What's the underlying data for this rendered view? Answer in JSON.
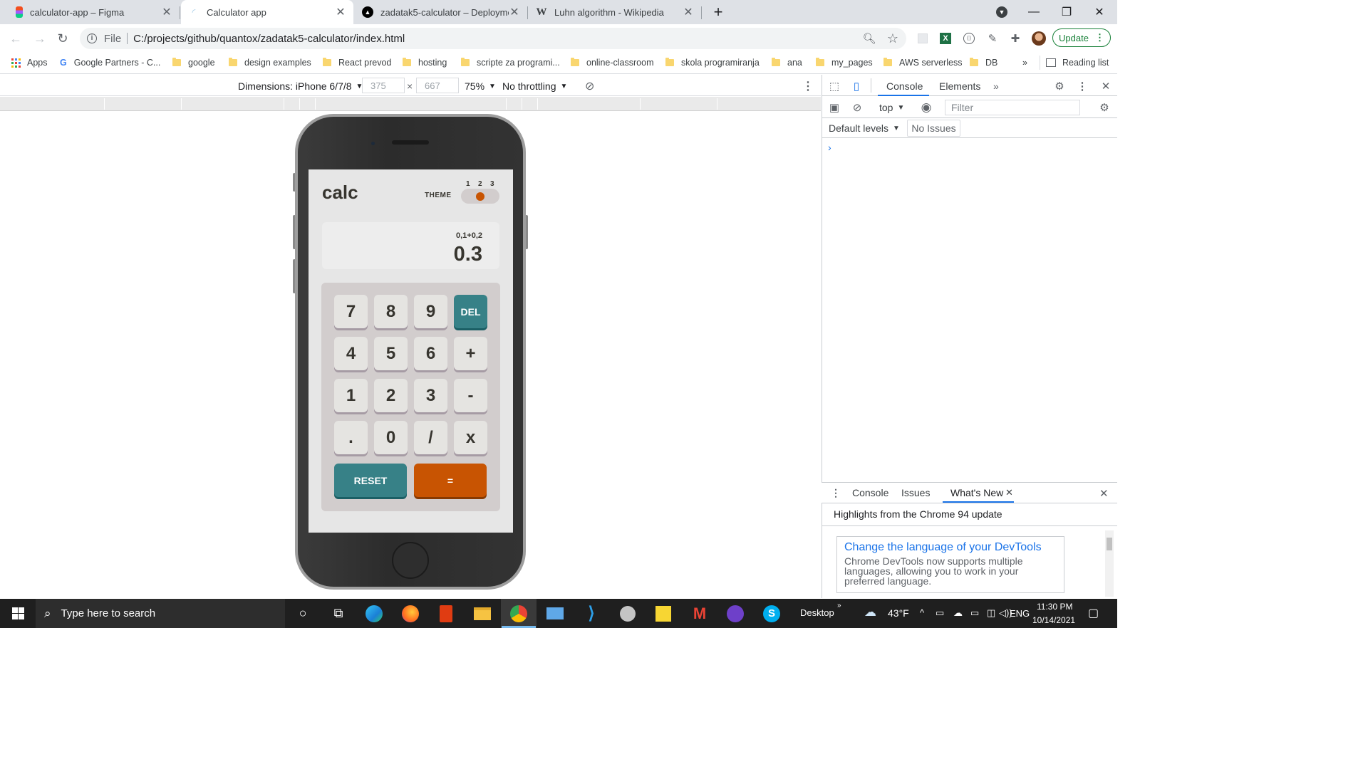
{
  "tabs": [
    {
      "title": "calculator-app – Figma",
      "favicon_color": "#f24e1e",
      "active": false
    },
    {
      "title": "Calculator app",
      "favicon_color": "#9ec9e6",
      "active": true
    },
    {
      "title": "zadatak5-calculator – Deploymen",
      "favicon_color": "#000000",
      "active": false
    },
    {
      "title": "Luhn algorithm - Wikipedia",
      "favicon_color": "#ffffff",
      "active": false
    }
  ],
  "new_tab_icon": "plus-icon",
  "address": {
    "scheme_label": "File",
    "url": "C:/projects/github/quantox/zadatak5-calculator/index.html"
  },
  "update_label": "Update",
  "bookmarks": [
    {
      "label": "Apps",
      "icon": "apps-grid-icon"
    },
    {
      "label": "Google Partners - C...",
      "icon": "google-icon"
    },
    {
      "label": "google",
      "icon": "folder-icon"
    },
    {
      "label": "design examples",
      "icon": "folder-icon"
    },
    {
      "label": "React prevod",
      "icon": "folder-icon"
    },
    {
      "label": "hosting",
      "icon": "folder-icon"
    },
    {
      "label": "scripte za programi...",
      "icon": "folder-icon"
    },
    {
      "label": "online-classroom",
      "icon": "folder-icon"
    },
    {
      "label": "skola programiranja",
      "icon": "folder-icon"
    },
    {
      "label": "ana",
      "icon": "folder-icon"
    },
    {
      "label": "my_pages",
      "icon": "folder-icon"
    },
    {
      "label": "AWS serverless",
      "icon": "folder-icon"
    },
    {
      "label": "DB",
      "icon": "folder-icon"
    }
  ],
  "bookmarks_overflow": "»",
  "reading_list": "Reading list",
  "device_toolbar": {
    "dimensions_label": "Dimensions: iPhone 6/7/8",
    "width": "375",
    "times": "×",
    "height": "667",
    "zoom": "75%",
    "throttling": "No throttling"
  },
  "calculator": {
    "title": "calc",
    "theme_label": "THEME",
    "theme_numbers": [
      "1",
      "2",
      "3"
    ],
    "theme_selected": 2,
    "expression": "0,1+0,2",
    "result": "0.3",
    "keys": [
      "7",
      "8",
      "9",
      "DEL",
      "4",
      "5",
      "6",
      "+",
      "1",
      "2",
      "3",
      "-",
      ".",
      "0",
      "/",
      "x"
    ],
    "reset_label": "RESET",
    "equals_label": "=",
    "colors": {
      "accent": "#c85402",
      "key_teal": "#378187",
      "screen_bg": "#e6e6e6",
      "keypad_bg": "#d2cdcd"
    }
  },
  "devtools": {
    "tabs": [
      "Console",
      "Elements"
    ],
    "active_tab": "Console",
    "more": "»",
    "context": "top",
    "filter_placeholder": "Filter",
    "levels": "Default levels",
    "issues": "No Issues",
    "prompt": "›",
    "drawer_tabs": [
      "Console",
      "Issues",
      "What's New"
    ],
    "drawer_active": "What's New",
    "highlights": "Highlights from the Chrome 94 update",
    "card_title": "Change the language of your DevTools",
    "card_text": "Chrome DevTools now supports multiple languages, allowing you to work in your preferred language."
  },
  "taskbar": {
    "search_placeholder": "Type here to search",
    "desktop_label": "Desktop",
    "weather": "43°F",
    "language": "ENG",
    "time": "11:30 PM",
    "date": "10/14/2021"
  }
}
